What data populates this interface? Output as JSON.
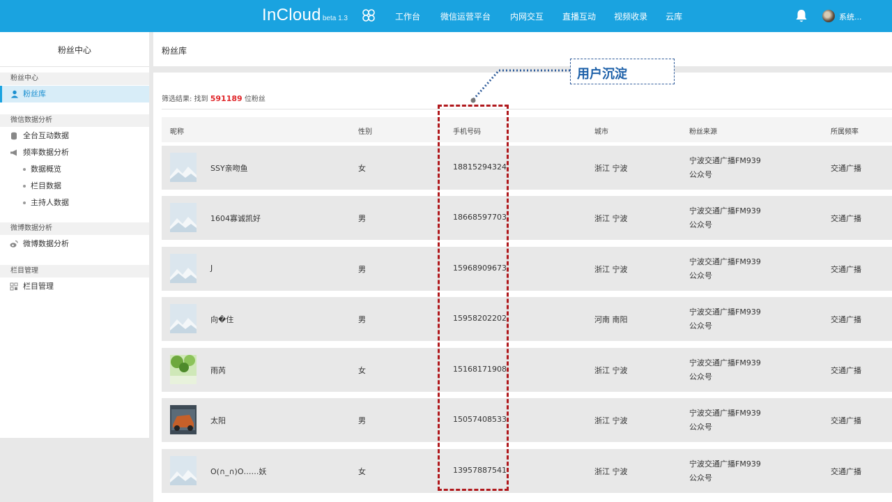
{
  "header": {
    "brand": "InCloud",
    "version": "beta 1.3",
    "nav": [
      "工作台",
      "微信运营平台",
      "内网交互",
      "直播互动",
      "视频收录",
      "云库"
    ],
    "user": "系统..."
  },
  "sidebar": {
    "title": "粉丝中心",
    "sections": [
      {
        "heading": "粉丝中心",
        "items": [
          {
            "label": "粉丝库",
            "icon": "user-icon",
            "active": true
          }
        ]
      },
      {
        "heading": "微信数据分析",
        "items": [
          {
            "label": "全台互动数据",
            "icon": "database-icon"
          },
          {
            "label": "频率数据分析",
            "icon": "megaphone-icon"
          },
          {
            "label": "数据概览",
            "sub": true
          },
          {
            "label": "栏目数据",
            "sub": true
          },
          {
            "label": "主持人数据",
            "sub": true
          }
        ]
      },
      {
        "heading": "微博数据分析",
        "items": [
          {
            "label": "微博数据分析",
            "icon": "weibo-icon"
          }
        ]
      },
      {
        "heading": "栏目管理",
        "items": [
          {
            "label": "栏目管理",
            "icon": "grid-icon"
          }
        ]
      }
    ]
  },
  "main": {
    "title": "粉丝库",
    "result_prefix": "筛选结果:  找到",
    "result_count": "591189",
    "result_suffix": "位粉丝",
    "columns": [
      "昵称",
      "性别",
      "手机号码",
      "城市",
      "粉丝来源",
      "所属频率"
    ],
    "rows": [
      {
        "nick": "SSY亲吻鱼",
        "gender": "女",
        "phone": "18815294324",
        "city": "浙江 宁波",
        "source_line1": "宁波交通广播FM939",
        "source_line2": "公众号",
        "channel": "交通广播",
        "avatar": "placeholder"
      },
      {
        "nick": "1604寡诚凯好",
        "gender": "男",
        "phone": "18668597703",
        "city": "浙江 宁波",
        "source_line1": "宁波交通广播FM939",
        "source_line2": "公众号",
        "channel": "交通广播",
        "avatar": "placeholder"
      },
      {
        "nick": "J",
        "gender": "男",
        "phone": "15968909673",
        "city": "浙江 宁波",
        "source_line1": "宁波交通广播FM939",
        "source_line2": "公众号",
        "channel": "交通广播",
        "avatar": "placeholder"
      },
      {
        "nick": "向�住",
        "gender": "男",
        "phone": "15958202202",
        "city": "河南 南阳",
        "source_line1": "宁波交通广播FM939",
        "source_line2": "公众号",
        "channel": "交通广播",
        "avatar": "placeholder"
      },
      {
        "nick": "雨芮",
        "gender": "女",
        "phone": "15168171908",
        "city": "浙江 宁波",
        "source_line1": "宁波交通广播FM939",
        "source_line2": "公众号",
        "channel": "交通广播",
        "avatar": "green-photo"
      },
      {
        "nick": "太阳",
        "gender": "男",
        "phone": "15057408533",
        "city": "浙江 宁波",
        "source_line1": "宁波交通广播FM939",
        "source_line2": "公众号",
        "channel": "交通广播",
        "avatar": "car-photo"
      },
      {
        "nick": "O(∩_∩)O……妖",
        "gender": "女",
        "phone": "13957887541",
        "city": "浙江 宁波",
        "source_line1": "宁波交通广播FM939",
        "source_line2": "公众号",
        "channel": "交通广播",
        "avatar": "placeholder"
      }
    ]
  },
  "annotation": {
    "label": "用户沉淀",
    "highlight": "手机号码"
  },
  "colors": {
    "topbar": "#1aa3e0",
    "highlight_red": "#e0262a",
    "annotation_blue": "#1b5fa8",
    "dash_red": "#b0181c"
  }
}
